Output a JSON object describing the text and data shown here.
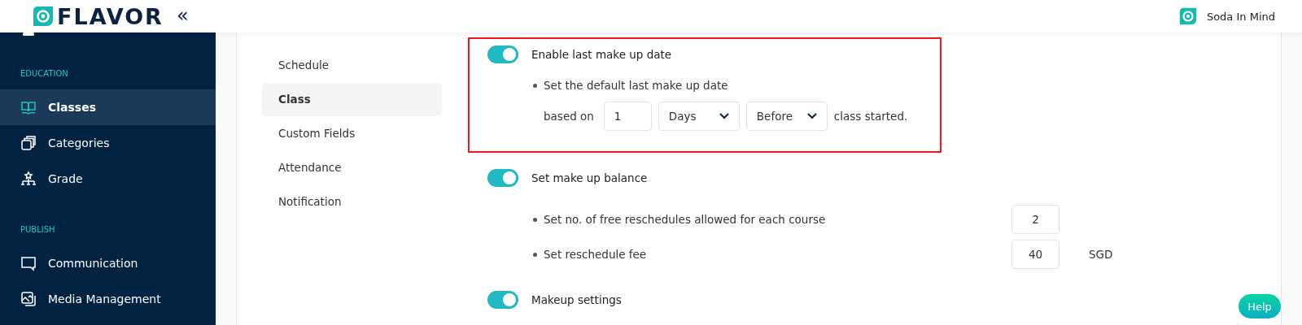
{
  "header": {
    "logo": "FLAVOR",
    "collapse": "«",
    "account": "Soda In Mind"
  },
  "sidebar": {
    "groups": [
      {
        "heading": "EDUCATION",
        "items": [
          {
            "label": "Classes",
            "selected": true
          },
          {
            "label": "Categories",
            "selected": false
          },
          {
            "label": "Grade",
            "selected": false
          }
        ]
      },
      {
        "heading": "PUBLISH",
        "items": [
          {
            "label": "Communication",
            "selected": false
          },
          {
            "label": "Media Management",
            "selected": false
          }
        ]
      }
    ]
  },
  "subnav": [
    {
      "label": "Schedule",
      "selected": false
    },
    {
      "label": "Class",
      "selected": true
    },
    {
      "label": "Custom Fields",
      "selected": false
    },
    {
      "label": "Attendance",
      "selected": false
    },
    {
      "label": "Notification",
      "selected": false
    }
  ],
  "sections": [
    {
      "kind": "date_rule",
      "title": "Enable last make up date",
      "on": true,
      "highlighted": true,
      "bullet": "Set the default last make up date",
      "prefix": "based on",
      "amount": "1",
      "unit": "Days",
      "relation": "Before",
      "suffix": "class started."
    },
    {
      "kind": "balance",
      "title": "Set make up balance",
      "on": true,
      "highlighted": false,
      "items": [
        {
          "label": "Set no. of free reschedules allowed for each course",
          "value": "2"
        },
        {
          "label": "Set reschedule fee",
          "value": "40",
          "unit": "SGD"
        }
      ]
    },
    {
      "kind": "plain",
      "title": "Makeup settings",
      "on": true,
      "highlighted": false
    }
  ],
  "help": "Help"
}
